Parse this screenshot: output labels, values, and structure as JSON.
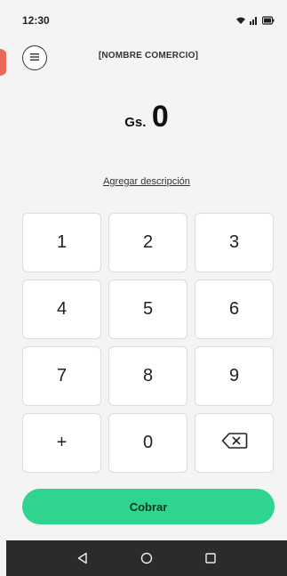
{
  "status": {
    "time": "12:30",
    "icons": [
      "wifi-icon",
      "signal-icon",
      "battery-icon"
    ]
  },
  "header": {
    "menu_icon": "hamburger-icon",
    "merchant_name": "[NOMBRE COMERCIO]"
  },
  "amount": {
    "currency": "Gs.",
    "value": "0"
  },
  "description_link": "Agregar descripción",
  "keypad": {
    "keys": [
      "1",
      "2",
      "3",
      "4",
      "5",
      "6",
      "7",
      "8",
      "9",
      "+",
      "0"
    ],
    "backspace_icon": "backspace-icon"
  },
  "charge_button": "Cobrar",
  "colors": {
    "accent": "#2fd58e",
    "side_indicator": "#e9685a",
    "navbar": "#2b2b2b"
  },
  "navbar": {
    "icons": [
      "back-icon",
      "home-icon",
      "recents-icon"
    ]
  }
}
